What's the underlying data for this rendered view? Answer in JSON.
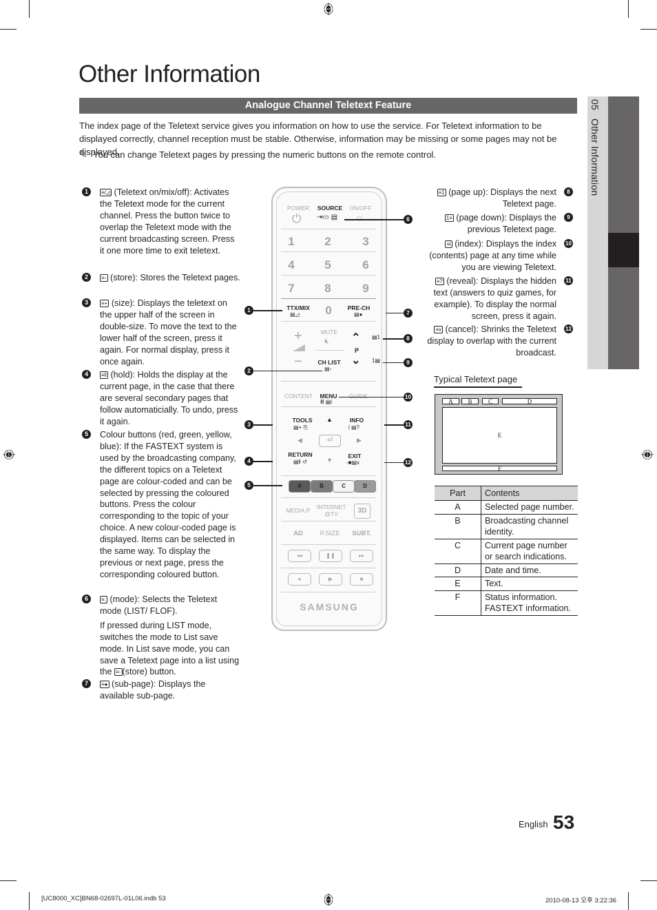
{
  "page": {
    "title": "Other Information",
    "section_title": "Analogue Channel Teletext Feature",
    "intro": "The index page of the Teletext service gives you information on how to use the service. For Teletext information to be displayed correctly, channel reception must be stable. Otherwise, information may be missing or some pages may not be displayed.",
    "note_icon": "pencil-note-icon",
    "note": "You can change Teletext pages by pressing the numeric buttons on the remote control."
  },
  "side_tab": {
    "number": "05",
    "label": "Other Information"
  },
  "left_items": [
    {
      "num": "1",
      "icon": "≡/◿",
      "text": "(Teletext on/mix/off): Activates the Teletext mode for the current channel. Press the button twice to overlap the Teletext mode with the current broadcasting screen. Press it one more time to exit teletext."
    },
    {
      "num": "2",
      "icon": "≡◦",
      "text": "(store): Stores the Teletext pages."
    },
    {
      "num": "3",
      "icon": "≡+",
      "text": "(size): Displays the teletext on the upper half of the screen in double-size. To move the text to the lower half of the screen, press it again. For normal display, press it once again."
    },
    {
      "num": "4",
      "icon": "≡‖",
      "text": "(hold): Holds the display at the current page, in the case that there are several secondary pages that follow automaticially. To undo, press it again."
    },
    {
      "num": "5",
      "icon": "",
      "text": "Colour buttons (red, green, yellow, blue): If the FASTEXT system is used by the broadcasting company, the different topics on a Teletext page are colour-coded and can be selected by pressing the coloured buttons. Press the colour corresponding to the topic of your choice. A new colour-coded page is displayed. Items can be selected in the same way. To display the previous or next page, press the corresponding coloured button."
    },
    {
      "num": "6",
      "icon": "≡.",
      "text": "(mode): Selects the Teletext mode (LIST/ FLOF).",
      "extra_before": "If pressed during LIST mode, switches the mode to List save mode. In List save mode, you can save a Teletext page into a list using the",
      "extra_icon": "≡◦",
      "extra_after": "(store) button."
    },
    {
      "num": "7",
      "icon": "≡●",
      "text": "(sub-page): Displays the available sub-page."
    }
  ],
  "right_items": [
    {
      "num": "8",
      "icon": "≡1",
      "text": "(page up): Displays the next Teletext page."
    },
    {
      "num": "9",
      "icon": "1≡",
      "text": "(page down): Displays the previous Teletext page."
    },
    {
      "num": "10",
      "icon": "≡i",
      "text": "(index): Displays the index (contents) page at any time while you are viewing Teletext."
    },
    {
      "num": "11",
      "icon": "≡?",
      "text": "(reveal): Displays the hidden text (answers to quiz games, for example). To display the normal screen, press it again."
    },
    {
      "num": "12",
      "icon": "≡x",
      "text": "(cancel): Shrinks the Teletext display to overlap with the current broadcast."
    }
  ],
  "remote": {
    "power": "POWER",
    "source": "SOURCE",
    "onoff": "ON/OFF",
    "digits": [
      "1",
      "2",
      "3",
      "4",
      "5",
      "6",
      "7",
      "8",
      "9",
      "0"
    ],
    "ttx": "TTX/MIX",
    "prech": "PRE-CH",
    "mute": "MUTE",
    "p": "P",
    "chlist": "CH LIST",
    "content": "CONTENT",
    "menu": "MENU",
    "guide": "GUIDE",
    "tools": "TOOLS",
    "info": "INFO",
    "return": "RETURN",
    "exit": "EXIT",
    "color_buttons": [
      "A",
      "B",
      "C",
      "D"
    ],
    "color_button_colors": [
      "#5a5a5a",
      "#7a7a7a",
      "#f4f4f4",
      "#9a9a9a"
    ],
    "mediap": "MEDIA.P",
    "internet": "INTERNET",
    "internet2": "@TV",
    "three_d": "3D",
    "ad": "AD",
    "psize": "P.SIZE",
    "subt": "SUBT.",
    "rew": "◂◂",
    "pause": "❚❚",
    "ff": "▸▸",
    "rec": "●",
    "play": "▶",
    "stop": "■",
    "brand": "SAMSUNG"
  },
  "teletext_diagram": {
    "title": "Typical Teletext page",
    "labels": {
      "A": "A",
      "B": "B",
      "C": "C",
      "D": "D",
      "E": "E",
      "F": "F"
    }
  },
  "parts_table": {
    "headers": [
      "Part",
      "Contents"
    ],
    "rows": [
      [
        "A",
        "Selected page number."
      ],
      [
        "B",
        "Broadcasting channel identity."
      ],
      [
        "C",
        "Current page number or search indications."
      ],
      [
        "D",
        "Date and time."
      ],
      [
        "E",
        "Text."
      ],
      [
        "F",
        "Status information. FASTEXT information."
      ]
    ]
  },
  "footer": {
    "language": "English",
    "page_number": "53",
    "slug_left": "[UC8000_XC]BN68-02697L-01L06.indb   53",
    "slug_right": "2010-08-13   오후 3:22:36"
  }
}
